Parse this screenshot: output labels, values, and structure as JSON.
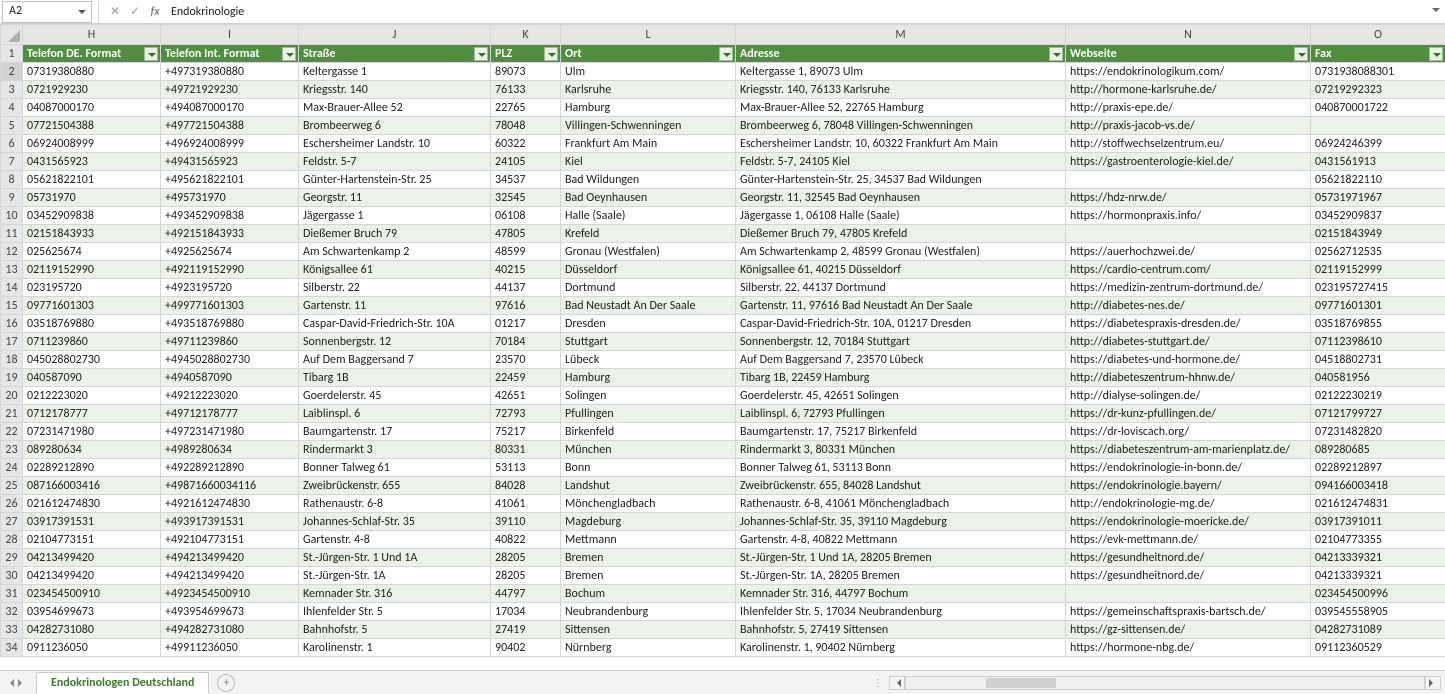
{
  "nameBox": "A2",
  "formula": "Endokrinologie",
  "sheetTab": "Endokrinologen Deutschland",
  "columns": [
    "H",
    "I",
    "J",
    "K",
    "L",
    "M",
    "N",
    "O"
  ],
  "headers": [
    "Telefon DE. Format",
    "Telefon Int. Format",
    "Straße",
    "PLZ",
    "Ort",
    "Adresse",
    "Webseite",
    "Fax"
  ],
  "rows": [
    [
      "07319380880",
      "+497319380880",
      "Keltergasse 1",
      "89073",
      "Ulm",
      "Keltergasse 1, 89073 Ulm",
      "https://endokrinologikum.com/",
      "0731938088301"
    ],
    [
      "0721929230",
      "+49721929230",
      "Kriegsstr. 140",
      "76133",
      "Karlsruhe",
      "Kriegsstr. 140, 76133 Karlsruhe",
      "http://hormone-karlsruhe.de/",
      "07219292323"
    ],
    [
      "04087000170",
      "+494087000170",
      "Max-Brauer-Allee 52",
      "22765",
      "Hamburg",
      "Max-Brauer-Allee 52, 22765 Hamburg",
      "http://praxis-epe.de/",
      "040870001722"
    ],
    [
      "07721504388",
      "+497721504388",
      "Brombeerweg 6",
      "78048",
      "Villingen-Schwenningen",
      "Brombeerweg 6, 78048 Villingen-Schwenningen",
      "http://praxis-jacob-vs.de/",
      ""
    ],
    [
      "06924008999",
      "+496924008999",
      "Eschersheimer Landstr. 10",
      "60322",
      "Frankfurt Am Main",
      "Eschersheimer Landstr. 10, 60322 Frankfurt Am Main",
      "http://stoffwechselzentrum.eu/",
      "06924246399"
    ],
    [
      "0431565923",
      "+49431565923",
      "Feldstr. 5-7",
      "24105",
      "Kiel",
      "Feldstr. 5-7, 24105 Kiel",
      "https://gastroenterologie-kiel.de/",
      "0431561913"
    ],
    [
      "05621822101",
      "+495621822101",
      "Günter-Hartenstein-Str. 25",
      "34537",
      "Bad Wildungen",
      "Günter-Hartenstein-Str. 25, 34537 Bad Wildungen",
      "",
      "05621822110"
    ],
    [
      "05731970",
      "+495731970",
      "Georgstr. 11",
      "32545",
      "Bad Oeynhausen",
      "Georgstr. 11, 32545 Bad Oeynhausen",
      "https://hdz-nrw.de/",
      "05731971967"
    ],
    [
      "03452909838",
      "+493452909838",
      "Jägergasse 1",
      "06108",
      "Halle (Saale)",
      "Jägergasse 1, 06108 Halle (Saale)",
      "https://hormonpraxis.info/",
      "03452909837"
    ],
    [
      "02151843933",
      "+492151843933",
      "Dießemer Bruch 79",
      "47805",
      "Krefeld",
      "Dießemer Bruch 79, 47805 Krefeld",
      "",
      "02151843949"
    ],
    [
      "025625674",
      "+4925625674",
      "Am Schwartenkamp 2",
      "48599",
      "Gronau (Westfalen)",
      "Am Schwartenkamp 2, 48599 Gronau (Westfalen)",
      "https://auerhochzwei.de/",
      "02562712535"
    ],
    [
      "02119152990",
      "+492119152990",
      "Königsallee 61",
      "40215",
      "Düsseldorf",
      "Königsallee 61, 40215 Düsseldorf",
      "https://cardio-centrum.com/",
      "02119152999"
    ],
    [
      "023195720",
      "+4923195720",
      "Silberstr. 22",
      "44137",
      "Dortmund",
      "Silberstr. 22, 44137 Dortmund",
      "https://medizin-zentrum-dortmund.de/",
      "023195727415"
    ],
    [
      "09771601303",
      "+499771601303",
      "Gartenstr. 11",
      "97616",
      "Bad Neustadt An Der Saale",
      "Gartenstr. 11, 97616 Bad Neustadt An Der Saale",
      "http://diabetes-nes.de/",
      "09771601301"
    ],
    [
      "03518769880",
      "+493518769880",
      "Caspar-David-Friedrich-Str. 10A",
      "01217",
      "Dresden",
      "Caspar-David-Friedrich-Str. 10A, 01217 Dresden",
      "https://diabetespraxis-dresden.de/",
      "03518769855"
    ],
    [
      "0711239860",
      "+49711239860",
      "Sonnenbergstr. 12",
      "70184",
      "Stuttgart",
      "Sonnenbergstr. 12, 70184 Stuttgart",
      "http://diabetes-stuttgart.de/",
      "07112398610"
    ],
    [
      "045028802730",
      "+4945028802730",
      "Auf Dem Baggersand 7",
      "23570",
      "Lübeck",
      "Auf Dem Baggersand 7, 23570 Lübeck",
      "https://diabetes-und-hormone.de/",
      "04518802731"
    ],
    [
      "040587090",
      "+4940587090",
      "Tibarg 1B",
      "22459",
      "Hamburg",
      "Tibarg 1B, 22459 Hamburg",
      "http://diabeteszentrum-hhnw.de/",
      "040581956"
    ],
    [
      "0212223020",
      "+49212223020",
      "Goerdelerstr. 45",
      "42651",
      "Solingen",
      "Goerdelerstr. 45, 42651 Solingen",
      "http://dialyse-solingen.de/",
      "02122230219"
    ],
    [
      "0712178777",
      "+49712178777",
      "Laiblinspl. 6",
      "72793",
      "Pfullingen",
      "Laiblinspl. 6, 72793 Pfullingen",
      "https://dr-kunz-pfullingen.de/",
      "07121799727"
    ],
    [
      "07231471980",
      "+497231471980",
      "Baumgartenstr. 17",
      "75217",
      "Birkenfeld",
      "Baumgartenstr. 17, 75217 Birkenfeld",
      "https://dr-loviscach.org/",
      "07231482820"
    ],
    [
      "089280634",
      "+4989280634",
      "Rindermarkt 3",
      "80331",
      "München",
      "Rindermarkt 3, 80331 München",
      "https://diabeteszentrum-am-marienplatz.de/",
      "089280685"
    ],
    [
      "02289212890",
      "+492289212890",
      "Bonner Talweg 61",
      "53113",
      "Bonn",
      "Bonner Talweg 61, 53113 Bonn",
      "https://endokrinologie-in-bonn.de/",
      "02289212897"
    ],
    [
      "087166003416",
      "+49871660034116",
      "Zweibrückenstr. 655",
      "84028",
      "Landshut",
      "Zweibrückenstr. 655, 84028 Landshut",
      "https://endokrinologie.bayern/",
      "094166003418"
    ],
    [
      "021612474830",
      "+4921612474830",
      "Rathenaustr. 6-8",
      "41061",
      "Mönchengladbach",
      "Rathenaustr. 6-8, 41061 Mönchengladbach",
      "http://endokrinologie-mg.de/",
      "021612474831"
    ],
    [
      "03917391531",
      "+493917391531",
      "Johannes-Schlaf-Str. 35",
      "39110",
      "Magdeburg",
      "Johannes-Schlaf-Str. 35, 39110 Magdeburg",
      "https://endokrinologie-moericke.de/",
      "03917391011"
    ],
    [
      "02104773151",
      "+492104773151",
      "Gartenstr. 4-8",
      "40822",
      "Mettmann",
      "Gartenstr. 4-8, 40822 Mettmann",
      "https://evk-mettmann.de/",
      "02104773355"
    ],
    [
      "04213499420",
      "+494213499420",
      "St.-Jürgen-Str. 1 Und 1A",
      "28205",
      "Bremen",
      "St.-Jürgen-Str. 1 Und 1A, 28205 Bremen",
      "https://gesundheitnord.de/",
      "04213339321"
    ],
    [
      "04213499420",
      "+494213499420",
      "St.-Jürgen-Str. 1A",
      "28205",
      "Bremen",
      "St.-Jürgen-Str. 1A, 28205 Bremen",
      "https://gesundheitnord.de/",
      "04213339321"
    ],
    [
      "023454500910",
      "+4923454500910",
      "Kemnader Str. 316",
      "44797",
      "Bochum",
      "Kemnader Str. 316, 44797 Bochum",
      "",
      "023454500996"
    ],
    [
      "03954699673",
      "+493954699673",
      "Ihlenfelder Str. 5",
      "17034",
      "Neubrandenburg",
      "Ihlenfelder Str. 5, 17034 Neubrandenburg",
      "https://gemeinschaftspraxis-bartsch.de/",
      "039545558905"
    ],
    [
      "04282731080",
      "+494282731080",
      "Bahnhofstr. 5",
      "27419",
      "Sittensen",
      "Bahnhofstr. 5, 27419 Sittensen",
      "https://gz-sittensen.de/",
      "04282731089"
    ],
    [
      "0911236050",
      "+49911236050",
      "Karolinenstr. 1",
      "90402",
      "Nürnberg",
      "Karolinenstr. 1, 90402 Nürnberg",
      "https://hormone-nbg.de/",
      "09112360529"
    ]
  ]
}
